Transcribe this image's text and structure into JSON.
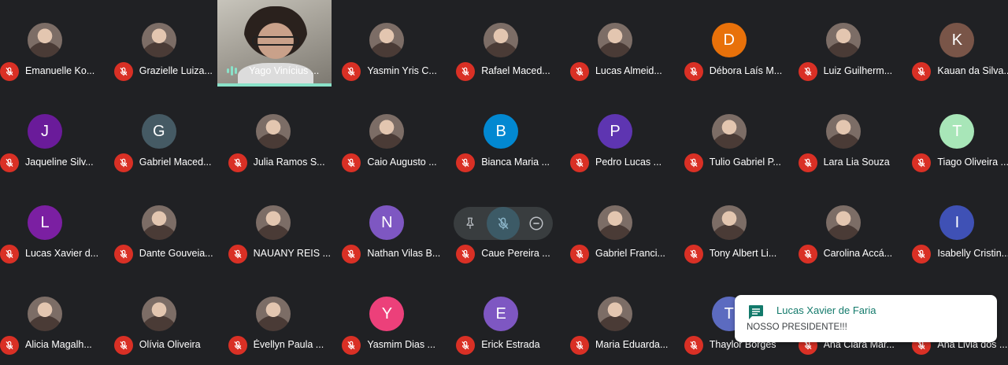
{
  "participants": [
    {
      "name": "Emanuelle Ko...",
      "avatar_type": "photo",
      "initial": "",
      "color": "#6d6660"
    },
    {
      "name": "Grazielle Luiza...",
      "avatar_type": "photo",
      "initial": "",
      "color": "#4e433f"
    },
    {
      "name": "Yago Vinícius ...",
      "avatar_type": "video",
      "initial": "",
      "color": ""
    },
    {
      "name": "Yasmin Yris C...",
      "avatar_type": "photo",
      "initial": "",
      "color": "#8a7f78"
    },
    {
      "name": "Rafael Maced...",
      "avatar_type": "photo",
      "initial": "",
      "color": "#e5c98f"
    },
    {
      "name": "Lucas Almeid...",
      "avatar_type": "photo",
      "initial": "",
      "color": "#5a5e66"
    },
    {
      "name": "Débora Laís M...",
      "avatar_type": "initial",
      "initial": "D",
      "color": "#e8710a"
    },
    {
      "name": "Luiz Guilherm...",
      "avatar_type": "photo",
      "initial": "",
      "color": "#b78aa5"
    },
    {
      "name": "Kauan da Silva...",
      "avatar_type": "initial",
      "initial": "K",
      "color": "#795548"
    },
    {
      "name": "Jaqueline Silv...",
      "avatar_type": "initial",
      "initial": "J",
      "color": "#6a1b9a"
    },
    {
      "name": "Gabriel Maced...",
      "avatar_type": "initial",
      "initial": "G",
      "color": "#455a64"
    },
    {
      "name": "Julia Ramos S...",
      "avatar_type": "photo",
      "initial": "",
      "color": "#4a3a34"
    },
    {
      "name": "Caio Augusto ...",
      "avatar_type": "photo",
      "initial": "",
      "color": "#5c6f8a"
    },
    {
      "name": "Bianca Maria ...",
      "avatar_type": "initial",
      "initial": "B",
      "color": "#0288d1"
    },
    {
      "name": "Pedro Lucas ...",
      "avatar_type": "initial",
      "initial": "P",
      "color": "#5e35b1"
    },
    {
      "name": "Tulio Gabriel P...",
      "avatar_type": "photo",
      "initial": "",
      "color": "#8d8f91"
    },
    {
      "name": "Lara Lia Souza",
      "avatar_type": "photo",
      "initial": "",
      "color": "#8b5a3c"
    },
    {
      "name": "Tiago Oliveira ...",
      "avatar_type": "initial",
      "initial": "T",
      "color": "#a8e6b8"
    },
    {
      "name": "Lucas Xavier d...",
      "avatar_type": "initial",
      "initial": "L",
      "color": "#7b1fa2"
    },
    {
      "name": "Dante Gouveia...",
      "avatar_type": "photo",
      "initial": "",
      "color": "#6e4a3e"
    },
    {
      "name": "NAUANY REIS ...",
      "avatar_type": "photo",
      "initial": "",
      "color": "#3a3a3a"
    },
    {
      "name": "Nathan Vilas B...",
      "avatar_type": "initial",
      "initial": "N",
      "color": "#7e57c2"
    },
    {
      "name": "Caue Pereira ...",
      "avatar_type": "hidden",
      "initial": "",
      "color": ""
    },
    {
      "name": "Gabriel Franci...",
      "avatar_type": "photo",
      "initial": "",
      "color": "#4c8f3c"
    },
    {
      "name": "Tony Albert Li...",
      "avatar_type": "photo",
      "initial": "",
      "color": "#3d4a40"
    },
    {
      "name": "Carolina Accá...",
      "avatar_type": "photo",
      "initial": "",
      "color": "#6a5e57"
    },
    {
      "name": "Isabelly Cristin...",
      "avatar_type": "initial",
      "initial": "I",
      "color": "#3f51b5"
    },
    {
      "name": "Alicia Magalh...",
      "avatar_type": "photo",
      "initial": "",
      "color": "#4a5a70"
    },
    {
      "name": "Olívia Oliveira",
      "avatar_type": "photo",
      "initial": "",
      "color": "#3e6e6a"
    },
    {
      "name": "Évellyn Paula ...",
      "avatar_type": "photo",
      "initial": "",
      "color": "#4d3a34"
    },
    {
      "name": "Yasmim Dias ...",
      "avatar_type": "initial",
      "initial": "Y",
      "color": "#ec407a"
    },
    {
      "name": "Erick Estrada",
      "avatar_type": "initial",
      "initial": "E",
      "color": "#7e57c2"
    },
    {
      "name": "Maria Eduarda...",
      "avatar_type": "photo",
      "initial": "",
      "color": "#2e2e2e"
    },
    {
      "name": "Thaylor Borges",
      "avatar_type": "initial",
      "initial": "T",
      "color": "#5c6bc0"
    },
    {
      "name": "Ana Clara Mar...",
      "avatar_type": "hidden",
      "initial": "",
      "color": ""
    },
    {
      "name": "Ana Livia dos ...",
      "avatar_type": "hidden",
      "initial": "",
      "color": ""
    }
  ],
  "notification": {
    "sender": "Lucas Xavier de Faria",
    "message": "NOSSO PRESIDENTE!!!"
  },
  "colors": {
    "background": "#202124",
    "mute_red": "#d93025",
    "speaking_teal": "#8ae2c9"
  }
}
